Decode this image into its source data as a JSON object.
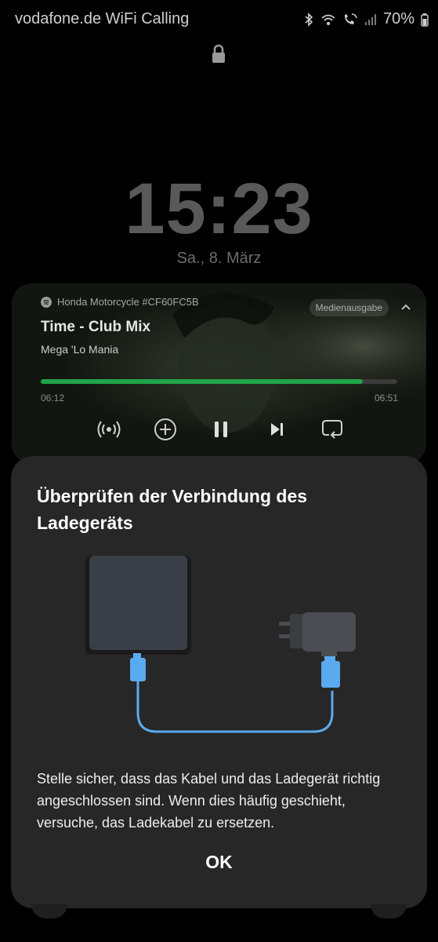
{
  "status_bar": {
    "carrier": "vodafone.de WiFi Calling",
    "battery": "70%",
    "icons": [
      "bluetooth-icon",
      "wifi-icon",
      "wifi-calling-icon",
      "signal-icon",
      "battery-icon"
    ]
  },
  "lockscreen": {
    "time": "15:23",
    "date": "Sa., 8. März"
  },
  "media": {
    "source": "Honda Motorcycle #CF60FC5B",
    "output_label": "Medienausgabe",
    "title": "Time - Club Mix",
    "artist": "Mega 'Lo Mania",
    "elapsed": "06:12",
    "total": "06:51",
    "progress": 0.904,
    "accent_color": "#22a34a",
    "controls": [
      "broadcast-icon",
      "add-icon",
      "pause-icon",
      "next-icon",
      "repeat-icon"
    ]
  },
  "dialog": {
    "title": "Überprüfen der Verbindung des Ladegeräts",
    "body": "Stelle sicher, dass das Kabel und das Ladegerät richtig angeschlossen sind. Wenn dies häufig geschieht, versuche, das Ladekabel zu ersetzen.",
    "ok_label": "OK",
    "cable_color": "#5aaaf0"
  }
}
